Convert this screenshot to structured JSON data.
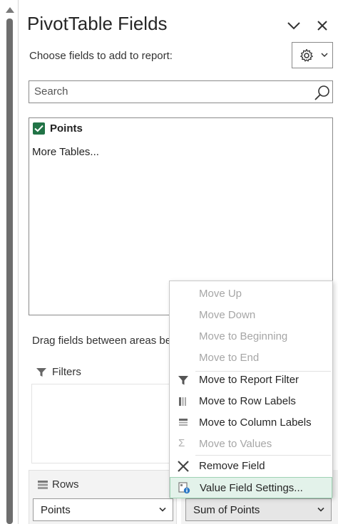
{
  "pane": {
    "title": "PivotTable Fields",
    "choose_label": "Choose fields to add to report:",
    "tools_icon": "gear-icon",
    "collapse_icon": "chevron-down-icon",
    "close_icon": "close-icon"
  },
  "search": {
    "placeholder": "Search",
    "icon": "search-icon"
  },
  "fields": {
    "items": [
      {
        "label": "Points",
        "checked": true
      }
    ],
    "more_tables": "More Tables..."
  },
  "areas": {
    "drag_text": "Drag fields between areas be",
    "filters_label": "Filters",
    "rows_label": "Rows",
    "rows_field": "Points",
    "values_field": "Sum of Points"
  },
  "context_menu": {
    "items": [
      {
        "label": "Move Up",
        "enabled": false
      },
      {
        "label": "Move Down",
        "enabled": false
      },
      {
        "label": "Move to Beginning",
        "enabled": false
      },
      {
        "label": "Move to End",
        "enabled": false
      },
      {
        "label": "Move to Report Filter",
        "enabled": true,
        "icon": "filter-icon"
      },
      {
        "label": "Move to Row Labels",
        "enabled": true,
        "icon": "row-labels-icon"
      },
      {
        "label": "Move to Column Labels",
        "enabled": true,
        "icon": "column-labels-icon"
      },
      {
        "label": "Move to Values",
        "enabled": false,
        "icon": "sigma-icon"
      },
      {
        "label": "Remove Field",
        "enabled": true,
        "icon": "remove-x-icon"
      },
      {
        "label": "Value Field Settings...",
        "enabled": true,
        "icon": "field-settings-icon",
        "highlighted": true
      }
    ]
  },
  "colors": {
    "checkbox_green": "#217346",
    "highlight_bg": "#e3f2ea",
    "disabled_text": "#a6a6a6"
  }
}
